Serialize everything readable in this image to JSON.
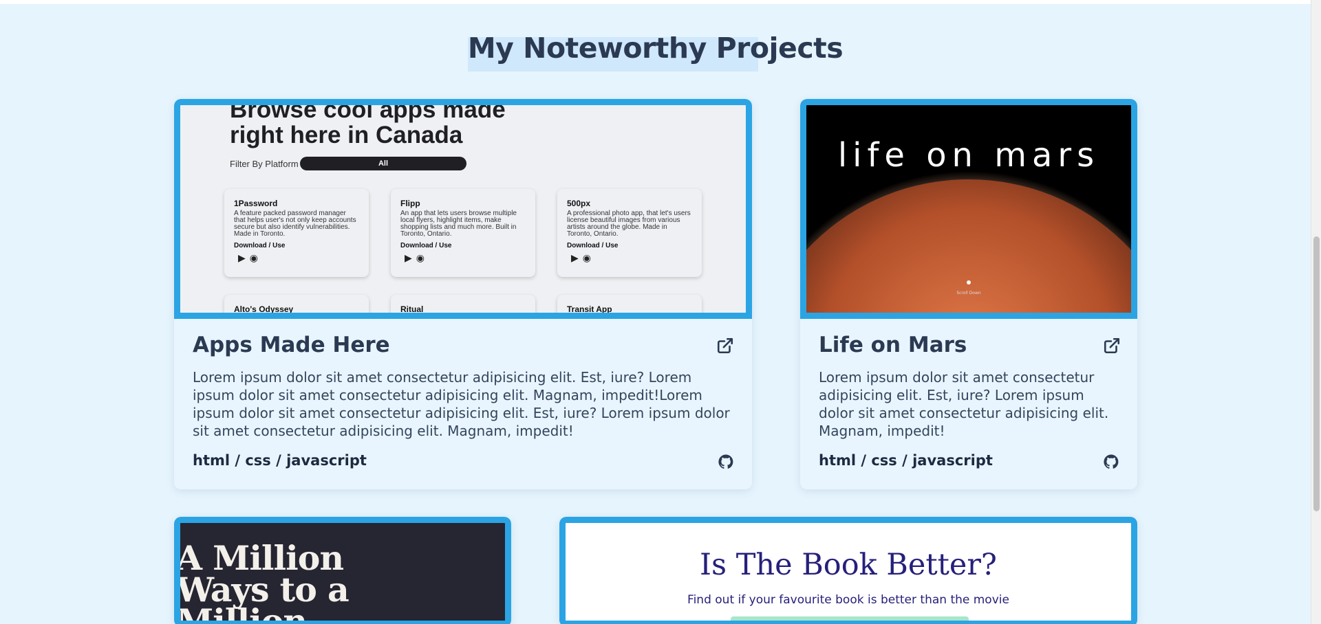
{
  "section": {
    "title": "My Noteworthy Projects"
  },
  "projects": [
    {
      "title": "Apps Made Here",
      "description": "Lorem ipsum dolor sit amet consectetur adipisicing elit. Est, iure? Lorem ipsum dolor sit amet consectetur adipisicing elit. Magnam, impedit!Lorem ipsum dolor sit amet consectetur adipisicing elit. Est, iure? Lorem ipsum dolor sit amet consectetur adipisicing elit. Magnam, impedit!",
      "tech": "html / css / javascript",
      "screenshot": {
        "heading": "Browse cool apps made right here in Canada",
        "filter_label": "Filter By Platform",
        "filter_value": "All",
        "apps": [
          {
            "name": "1Password",
            "desc": "A feature packed password manager that helps user's not only keep accounts secure but also identify vulnerabilities. Made in Toronto.",
            "download": "Download / Use"
          },
          {
            "name": "Flipp",
            "desc": "An app that lets users browse multiple local flyers, highlight items, make shopping lists and much more. Built in Toronto, Ontario.",
            "download": "Download / Use"
          },
          {
            "name": "500px",
            "desc": "A professional photo app, that let's users license beautiful images from various artists around the globe. Made in Toronto, Ontario.",
            "download": "Download / Use"
          }
        ],
        "more_apps": [
          "Alto's Odyssey",
          "Ritual",
          "Transit App"
        ]
      }
    },
    {
      "title": "Life on Mars",
      "description": "Lorem ipsum dolor sit amet consectetur adipisicing elit. Est, iure? Lorem ipsum dolor sit amet consectetur adipisicing elit. Magnam, impedit!",
      "tech": "html / css / javascript",
      "screenshot": {
        "heading": "life on mars",
        "scroll": "Scroll Down"
      }
    },
    {
      "screenshot": {
        "heading": "A Million Ways to a Million"
      }
    },
    {
      "screenshot": {
        "heading": "Is The Book Better?",
        "subtitle": "Find out if your favourite book is better than the movie"
      }
    }
  ],
  "colors": {
    "accent": "#2ba4e4",
    "background": "#e6f4fd",
    "heading": "#2b3a52"
  },
  "icons": {
    "external": "external-link-icon",
    "github": "github-icon"
  }
}
